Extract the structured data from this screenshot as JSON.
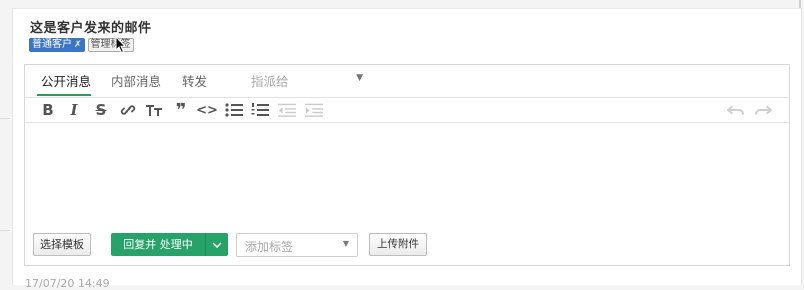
{
  "ticket": {
    "subject": "这是客户发来的邮件",
    "tags": [
      {
        "label": "普通客户",
        "removable_glyph": "✗",
        "style": "primary"
      },
      {
        "label": "管理标签",
        "style": "secondary"
      }
    ]
  },
  "editor": {
    "tabs": [
      {
        "label": "公开消息",
        "active": true
      },
      {
        "label": "内部消息",
        "active": false
      },
      {
        "label": "转发",
        "active": false
      }
    ],
    "assign_placeholder": "指派给",
    "toolbar": {
      "icons": [
        "bold-icon",
        "italic-icon",
        "strikethrough-icon",
        "link-icon",
        "heading-icon",
        "quote-icon",
        "code-icon",
        "bullet-list-icon",
        "numbered-list-icon",
        "outdent-icon",
        "indent-icon",
        "undo-icon",
        "redo-icon"
      ]
    },
    "actions": {
      "template_button": "选择模板",
      "reply_button": "回复并 处理中",
      "tag_placeholder": "添加标签",
      "upload_button": "上传附件"
    }
  },
  "timestamp": "17/07/20 14:49",
  "colors": {
    "accent_green": "#27a36a",
    "tag_blue": "#3b76c4",
    "tab_underline": "#2a9d5c"
  }
}
